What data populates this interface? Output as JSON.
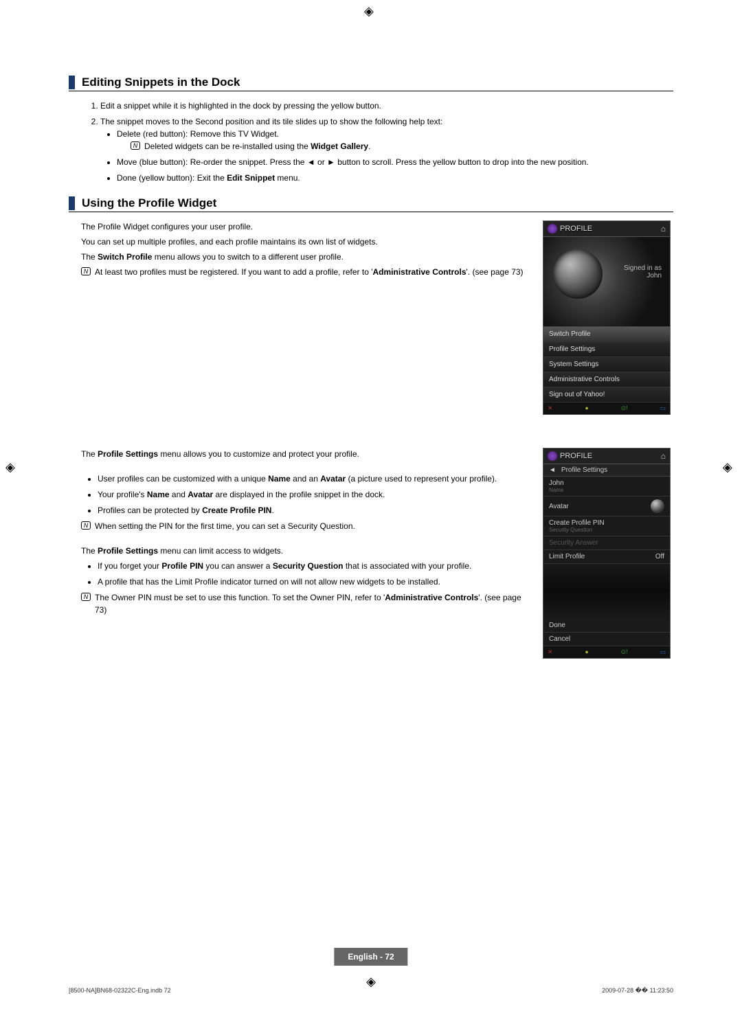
{
  "section1": {
    "title": "Editing Snippets in the Dock",
    "item1": "Edit a snippet while it is highlighted in the dock by pressing the yellow button.",
    "item2": "The snippet moves to the Second position and its tile slides up to show the following help text:",
    "sub1": "Delete (red button): Remove this TV Widget.",
    "note1a": "Deleted widgets can be re-installed using the ",
    "note1b": "Widget Gallery",
    "note1c": ".",
    "sub2": "Move (blue button): Re-order the snippet. Press the ◄ or ► button to scroll. Press the yellow button to drop into the new position.",
    "sub3a": "Done (yellow button): Exit the ",
    "sub3b": "Edit Snippet",
    "sub3c": " menu."
  },
  "section2": {
    "title": "Using the Profile Widget",
    "p1": "The Profile Widget configures your user profile.",
    "p2": "You can set up multiple profiles, and each profile maintains its own list of widgets.",
    "p3a": "The ",
    "p3b": "Switch Profile",
    "p3c": " menu allows you to switch to a different user profile.",
    "note_a": "At least two profiles must be registered. If you want to add a profile, refer to '",
    "note_b": "Administrative Controls",
    "note_c": "'. (see page 73)",
    "ps_intro_a": "The ",
    "ps_intro_b": "Profile Settings",
    "ps_intro_c": " menu allows you to customize and protect your profile.",
    "b1a": "User profiles can be customized with a unique ",
    "b1b": "Name",
    "b1c": " and an ",
    "b1d": "Avatar",
    "b1e": " (a picture used to represent your profile).",
    "b2a": "Your profile's ",
    "b2b": "Name",
    "b2c": " and ",
    "b2d": "Avatar",
    "b2e": " are displayed in the profile snippet in the dock.",
    "b3a": "Profiles can be protected by ",
    "b3b": "Create Profile PIN",
    "b3c": ".",
    "note2": "When setting the PIN for the first time, you can set a Security Question.",
    "limit_intro_a": "The ",
    "limit_intro_b": "Profile Settings",
    "limit_intro_c": " menu can limit access to widgets.",
    "l1a": "If you forget your ",
    "l1b": "Profile PIN",
    "l1c": " you can answer a ",
    "l1d": "Security Question",
    "l1e": " that is associated with your profile.",
    "l2": "A profile that has the Limit Profile indicator turned on will not allow new widgets to be installed.",
    "note3a": "The Owner PIN must be set to use this function. To set the Owner PIN, refer to '",
    "note3b": "Administrative Controls",
    "note3c": "'. (see page 73)"
  },
  "widget1": {
    "header": "PROFILE",
    "signed": "Signed in as",
    "user": "John",
    "menu": [
      "Switch Profile",
      "Profile Settings",
      "System Settings",
      "Administrative Controls",
      "Sign out of Yahoo!"
    ]
  },
  "widget2": {
    "header": "PROFILE",
    "sub": "Profile Settings",
    "name": "John",
    "name_lbl": "Name",
    "avatar": "Avatar",
    "cpin": "Create Profile PIN",
    "sq": "Security Question",
    "sa": "Security Answer",
    "lp": "Limit Profile",
    "lp_val": "Off",
    "done": "Done",
    "cancel": "Cancel"
  },
  "footer": {
    "page": "English - 72",
    "file": "[8500-NA]BN68-02322C-Eng.indb   72",
    "date": "2009-07-28   �� 11:23:50"
  }
}
